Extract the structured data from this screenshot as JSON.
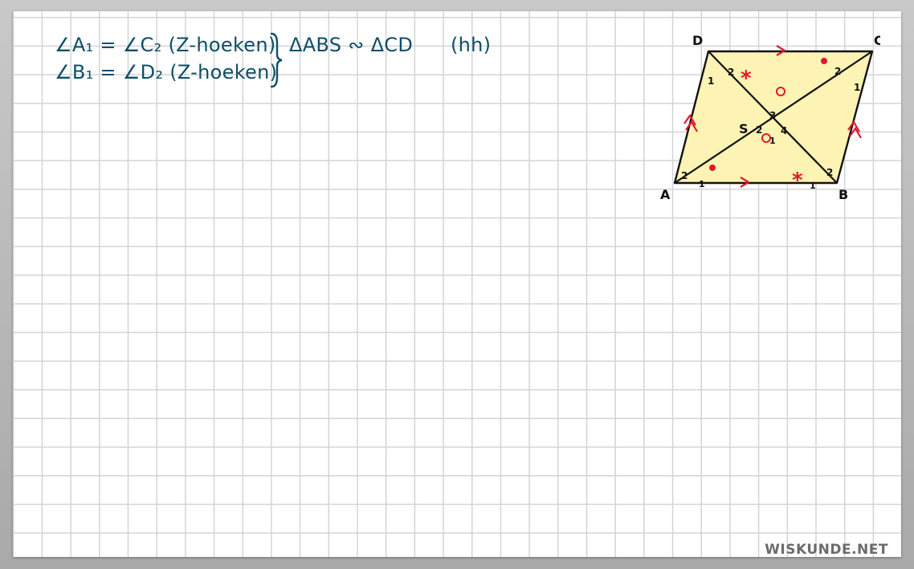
{
  "proof": {
    "line1": "∠A₁ = ∠C₂ (Z-hoeken)",
    "line2": "∠B₁ = ∠D₂ (Z-hoeken)",
    "conclusion": "ΔABS ∾ ΔCD",
    "reason": "(hh)"
  },
  "figure": {
    "vertices": {
      "A": "A",
      "B": "B",
      "C": "C",
      "D": "D",
      "S": "S"
    },
    "angle_numbers": {
      "D1": "1",
      "D2": "2",
      "C1": "1",
      "C2": "2",
      "A1": "1",
      "A2": "2",
      "B1": "1",
      "B2": "2",
      "S1": "1",
      "S2": "2",
      "S3": "3",
      "S4": "4"
    },
    "marks": {
      "star": "*",
      "circle": "o"
    },
    "colors": {
      "fill": "#fdf3b4",
      "edge": "#111111",
      "marks": "#e0182d"
    }
  },
  "watermark": "WISKUNDE.NET"
}
